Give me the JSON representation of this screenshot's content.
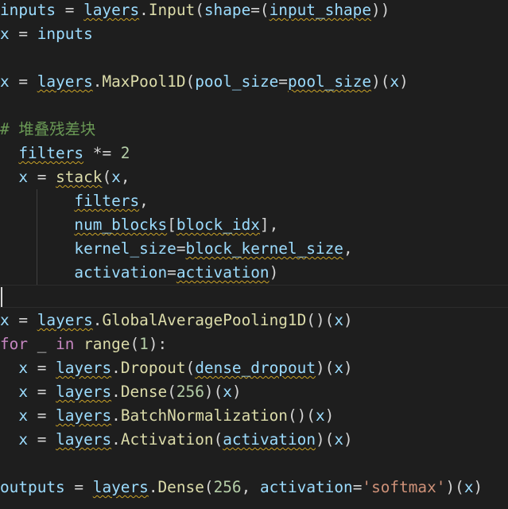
{
  "code_lines": [
    {
      "tokens": [
        {
          "t": "inputs",
          "c": "v"
        },
        {
          "t": " = ",
          "c": "p"
        },
        {
          "t": "layers",
          "c": "v",
          "sq": true
        },
        {
          "t": ".",
          "c": "p"
        },
        {
          "t": "Input",
          "c": "f"
        },
        {
          "t": "(",
          "c": "p"
        },
        {
          "t": "shape",
          "c": "v"
        },
        {
          "t": "=(",
          "c": "p"
        },
        {
          "t": "input_shape",
          "c": "v",
          "sq": true
        },
        {
          "t": "))",
          "c": "p"
        }
      ]
    },
    {
      "tokens": [
        {
          "t": "x",
          "c": "v"
        },
        {
          "t": " = ",
          "c": "p"
        },
        {
          "t": "inputs",
          "c": "v"
        }
      ]
    },
    {
      "tokens": []
    },
    {
      "tokens": [
        {
          "t": "x",
          "c": "v"
        },
        {
          "t": " = ",
          "c": "p"
        },
        {
          "t": "layers",
          "c": "v",
          "sq": true
        },
        {
          "t": ".",
          "c": "p"
        },
        {
          "t": "MaxPool1D",
          "c": "f"
        },
        {
          "t": "(",
          "c": "p"
        },
        {
          "t": "pool_size",
          "c": "v"
        },
        {
          "t": "=",
          "c": "p"
        },
        {
          "t": "pool_size",
          "c": "v",
          "sq": true
        },
        {
          "t": ")(",
          "c": "p"
        },
        {
          "t": "x",
          "c": "v"
        },
        {
          "t": ")",
          "c": "p"
        }
      ]
    },
    {
      "tokens": []
    },
    {
      "tokens": [
        {
          "t": "# 堆叠残差块",
          "c": "c"
        }
      ]
    },
    {
      "tokens": [
        {
          "t": "  ",
          "c": "p"
        },
        {
          "t": "filters",
          "c": "v",
          "sq": true
        },
        {
          "t": " *= ",
          "c": "p"
        },
        {
          "t": "2",
          "c": "n"
        }
      ]
    },
    {
      "tokens": [
        {
          "t": "  ",
          "c": "p"
        },
        {
          "t": "x",
          "c": "v"
        },
        {
          "t": " = ",
          "c": "p"
        },
        {
          "t": "stack",
          "c": "f",
          "sq": true
        },
        {
          "t": "(",
          "c": "p"
        },
        {
          "t": "x",
          "c": "v"
        },
        {
          "t": ",",
          "c": "p"
        }
      ]
    },
    {
      "tokens": [
        {
          "t": "        ",
          "c": "p"
        },
        {
          "t": "filters",
          "c": "v",
          "sq": true
        },
        {
          "t": ",",
          "c": "p"
        }
      ]
    },
    {
      "tokens": [
        {
          "t": "        ",
          "c": "p"
        },
        {
          "t": "num_blocks",
          "c": "v",
          "sq": true
        },
        {
          "t": "[",
          "c": "p"
        },
        {
          "t": "block_idx",
          "c": "v",
          "sq": true
        },
        {
          "t": "],",
          "c": "p"
        }
      ]
    },
    {
      "tokens": [
        {
          "t": "        ",
          "c": "p"
        },
        {
          "t": "kernel_size",
          "c": "v"
        },
        {
          "t": "=",
          "c": "p"
        },
        {
          "t": "block_kernel_size",
          "c": "v",
          "sq": true
        },
        {
          "t": ",",
          "c": "p"
        }
      ]
    },
    {
      "tokens": [
        {
          "t": "        ",
          "c": "p"
        },
        {
          "t": "activation",
          "c": "v"
        },
        {
          "t": "=",
          "c": "p"
        },
        {
          "t": "activation",
          "c": "v",
          "sq": true
        },
        {
          "t": ")",
          "c": "p"
        }
      ]
    },
    {
      "tokens": []
    },
    {
      "tokens": [
        {
          "t": "x",
          "c": "v"
        },
        {
          "t": " = ",
          "c": "p"
        },
        {
          "t": "layers",
          "c": "v",
          "sq": true
        },
        {
          "t": ".",
          "c": "p"
        },
        {
          "t": "GlobalAveragePooling1D",
          "c": "f"
        },
        {
          "t": "()(",
          "c": "p"
        },
        {
          "t": "x",
          "c": "v"
        },
        {
          "t": ")",
          "c": "p"
        }
      ]
    },
    {
      "tokens": [
        {
          "t": "for",
          "c": "k"
        },
        {
          "t": " _ ",
          "c": "p"
        },
        {
          "t": "in",
          "c": "k"
        },
        {
          "t": " ",
          "c": "p"
        },
        {
          "t": "range",
          "c": "f"
        },
        {
          "t": "(",
          "c": "p"
        },
        {
          "t": "1",
          "c": "n"
        },
        {
          "t": "):",
          "c": "p"
        }
      ]
    },
    {
      "tokens": [
        {
          "t": "  ",
          "c": "p"
        },
        {
          "t": "x",
          "c": "v"
        },
        {
          "t": " = ",
          "c": "p"
        },
        {
          "t": "layers",
          "c": "v",
          "sq": true
        },
        {
          "t": ".",
          "c": "p"
        },
        {
          "t": "Dropout",
          "c": "f"
        },
        {
          "t": "(",
          "c": "p"
        },
        {
          "t": "dense_dropout",
          "c": "v",
          "sq": true
        },
        {
          "t": ")(",
          "c": "p"
        },
        {
          "t": "x",
          "c": "v"
        },
        {
          "t": ")",
          "c": "p"
        }
      ]
    },
    {
      "tokens": [
        {
          "t": "  ",
          "c": "p"
        },
        {
          "t": "x",
          "c": "v"
        },
        {
          "t": " = ",
          "c": "p"
        },
        {
          "t": "layers",
          "c": "v",
          "sq": true
        },
        {
          "t": ".",
          "c": "p"
        },
        {
          "t": "Dense",
          "c": "f"
        },
        {
          "t": "(",
          "c": "p"
        },
        {
          "t": "256",
          "c": "n"
        },
        {
          "t": ")(",
          "c": "p"
        },
        {
          "t": "x",
          "c": "v"
        },
        {
          "t": ")",
          "c": "p"
        }
      ]
    },
    {
      "tokens": [
        {
          "t": "  ",
          "c": "p"
        },
        {
          "t": "x",
          "c": "v"
        },
        {
          "t": " = ",
          "c": "p"
        },
        {
          "t": "layers",
          "c": "v",
          "sq": true
        },
        {
          "t": ".",
          "c": "p"
        },
        {
          "t": "BatchNormalization",
          "c": "f"
        },
        {
          "t": "()(",
          "c": "p"
        },
        {
          "t": "x",
          "c": "v"
        },
        {
          "t": ")",
          "c": "p"
        }
      ]
    },
    {
      "tokens": [
        {
          "t": "  ",
          "c": "p"
        },
        {
          "t": "x",
          "c": "v"
        },
        {
          "t": " = ",
          "c": "p"
        },
        {
          "t": "layers",
          "c": "v",
          "sq": true
        },
        {
          "t": ".",
          "c": "p"
        },
        {
          "t": "Activation",
          "c": "f"
        },
        {
          "t": "(",
          "c": "p"
        },
        {
          "t": "activation",
          "c": "v",
          "sq": true
        },
        {
          "t": ")(",
          "c": "p"
        },
        {
          "t": "x",
          "c": "v"
        },
        {
          "t": ")",
          "c": "p"
        }
      ]
    },
    {
      "tokens": []
    },
    {
      "tokens": [
        {
          "t": "outputs",
          "c": "v"
        },
        {
          "t": " = ",
          "c": "p"
        },
        {
          "t": "layers",
          "c": "v",
          "sq": true
        },
        {
          "t": ".",
          "c": "p"
        },
        {
          "t": "Dense",
          "c": "f"
        },
        {
          "t": "(",
          "c": "p"
        },
        {
          "t": "256",
          "c": "n"
        },
        {
          "t": ", ",
          "c": "p"
        },
        {
          "t": "activation",
          "c": "v"
        },
        {
          "t": "=",
          "c": "p"
        },
        {
          "t": "'softmax'",
          "c": "s"
        },
        {
          "t": ")(",
          "c": "p"
        },
        {
          "t": "x",
          "c": "v"
        },
        {
          "t": ")",
          "c": "p"
        }
      ]
    }
  ],
  "theme": {
    "background": "#1e1e1e",
    "variable": "#9cdcfe",
    "function": "#dcdcaa",
    "keyword": "#c586c0",
    "number": "#b5cea8",
    "string": "#ce9178",
    "comment": "#6a9955",
    "squiggle": "#c9a227"
  }
}
